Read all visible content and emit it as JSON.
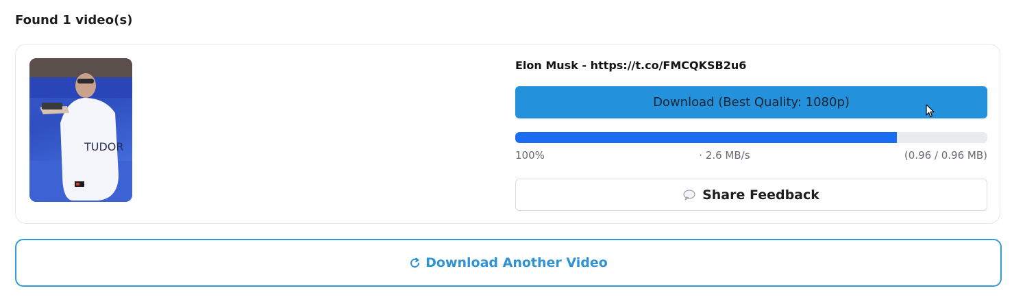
{
  "heading": "Found 1 video(s)",
  "video": {
    "title": "Elon Musk - https://t.co/FMCQKSB2u6",
    "thumbnail_icon": "video-thumbnail"
  },
  "download_button": {
    "label": "Download (Best Quality: 1080p)",
    "color": "#2391dc"
  },
  "progress": {
    "fill_fraction": 0.808,
    "percent": "100%",
    "speed": "· 2.6 MB/s",
    "size": "(0.96 / 0.96 MB)",
    "color": "#1a6cf0"
  },
  "feedback_button": {
    "label": "Share Feedback",
    "icon": "speech-bubble-icon"
  },
  "another_button": {
    "label": "Download Another Video",
    "icon": "refresh-icon",
    "color": "#2f93d3"
  }
}
